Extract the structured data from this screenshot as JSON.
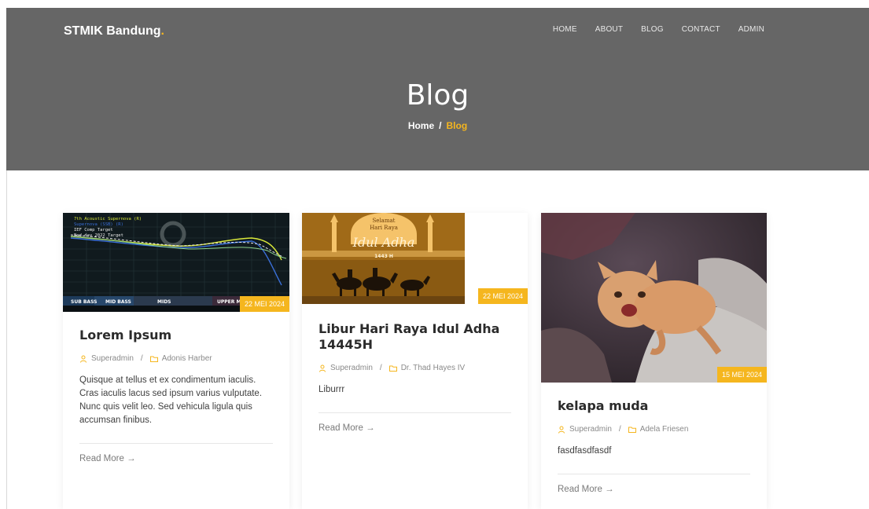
{
  "brand": {
    "name": "STMIK Bandung",
    "dot": "."
  },
  "nav": [
    {
      "label": "HOME"
    },
    {
      "label": "ABOUT"
    },
    {
      "label": "BLOG"
    },
    {
      "label": "CONTACT"
    },
    {
      "label": "ADMIN"
    }
  ],
  "hero": {
    "title": "Blog"
  },
  "breadcrumb": {
    "home": "Home",
    "separator": "/",
    "current": "Blog"
  },
  "posts": [
    {
      "date": "22 MEI 2024",
      "title": "Lorem Ipsum",
      "author": "Superadmin",
      "category": "Adonis Harber",
      "excerpt": "Quisque at tellus et ex condimentum iaculis. Cras iaculis lacus sed ipsum varius vulputate. Nunc quis velit leo. Sed vehicula ligula quis accumsan finibus.",
      "read_more": "Read More →",
      "image": {
        "legend": [
          "7th Acoustic Supernova (R)",
          "Supernova (SSB) (R)",
          "IEF Comp Target",
          "Bad day 2022 Target"
        ],
        "bands": [
          "SUB BASS",
          "MID BASS",
          "MIDS",
          "UPPER M"
        ]
      }
    },
    {
      "date": "22 MEI 2024",
      "title": "Libur Hari Raya Idul Adha 14445H",
      "author": "Superadmin",
      "category": "Dr. Thad Hayes IV",
      "excerpt": "Liburrr",
      "read_more": "Read More →",
      "image": {
        "line1": "Selamat",
        "line2": "Hari Raya",
        "line3": "Idul Adha",
        "line4": "1443 H"
      }
    },
    {
      "date": "15 MEI 2024",
      "title": "kelapa muda",
      "author": "Superadmin",
      "category": "Adela Friesen",
      "excerpt": "fasdfasdfasdf",
      "read_more": "Read More →"
    }
  ],
  "colors": {
    "accent": "#f5b61e",
    "hero_bg": "#666666"
  },
  "icons": {
    "author": "user-icon",
    "category": "folder-icon",
    "arrow": "arrow-right-icon"
  }
}
